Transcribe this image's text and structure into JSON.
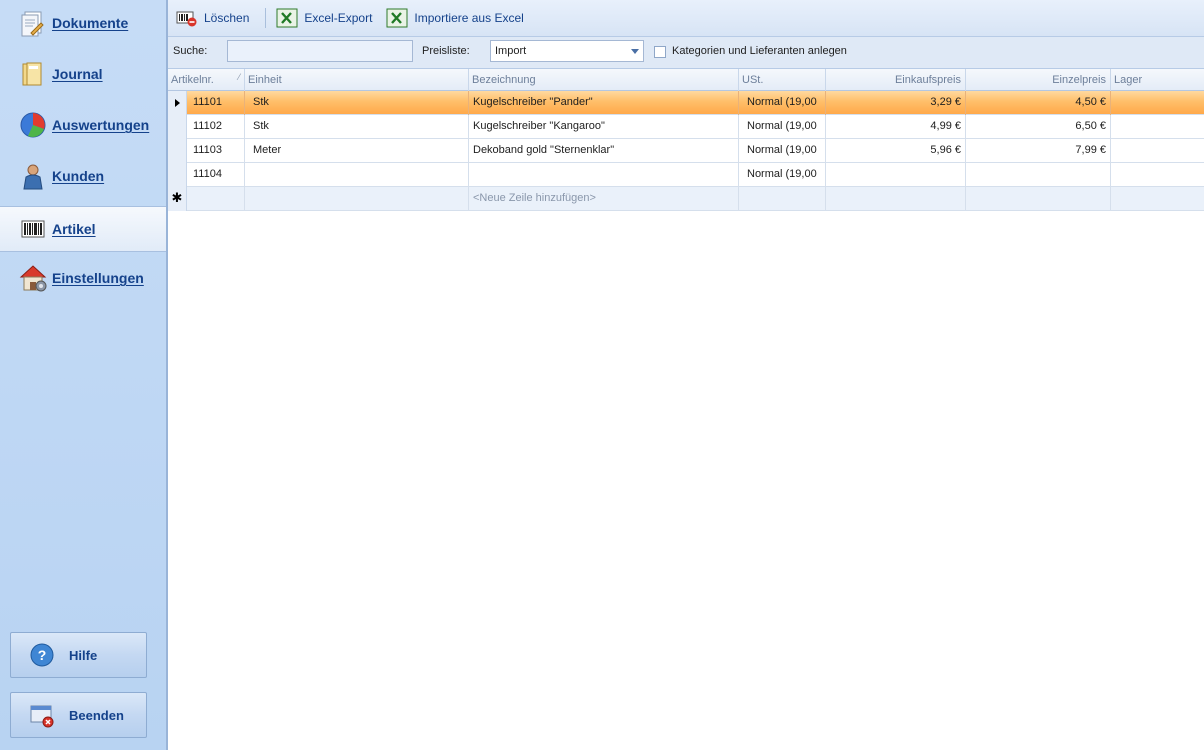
{
  "sidebar": {
    "items": [
      {
        "label": "Dokumente",
        "icon": "documents-icon"
      },
      {
        "label": "Journal",
        "icon": "journal-folder-icon"
      },
      {
        "label": "Auswertungen",
        "icon": "pie-chart-icon"
      },
      {
        "label": "Kunden",
        "icon": "customer-person-icon"
      },
      {
        "label": "Artikel",
        "icon": "barcode-icon",
        "active": true
      },
      {
        "label": "Einstellungen",
        "icon": "house-settings-icon"
      }
    ],
    "help_label": "Hilfe",
    "exit_label": "Beenden"
  },
  "toolbar": {
    "delete_label": "Löschen",
    "excel_export_label": "Excel-Export",
    "excel_import_label": "Importiere aus Excel"
  },
  "filter": {
    "search_label": "Suche:",
    "search_value": "",
    "pricelist_label": "Preisliste:",
    "pricelist_value": "Import",
    "create_categories_label": "Kategorien und Lieferanten anlegen",
    "create_categories_checked": false
  },
  "grid": {
    "columns": [
      "Artikelnr.",
      "Einheit",
      "Bezeichnung",
      "USt.",
      "Einkaufspreis",
      "Einzelpreis",
      "Lager"
    ],
    "rows": [
      {
        "nr": "11101",
        "einheit": "Stk",
        "bezeichnung": "Kugelschreiber \"Pander\"",
        "ust": "Normal (19,00",
        "einkauf": "3,29 €",
        "einzel": "4,50 €",
        "lager": ""
      },
      {
        "nr": "11102",
        "einheit": "Stk",
        "bezeichnung": "Kugelschreiber \"Kangaroo\"",
        "ust": "Normal (19,00",
        "einkauf": "4,99 €",
        "einzel": "6,50 €",
        "lager": ""
      },
      {
        "nr": "11103",
        "einheit": "Meter",
        "bezeichnung": "Dekoband gold \"Sternenklar\"",
        "ust": "Normal (19,00",
        "einkauf": "5,96 €",
        "einzel": "7,99 €",
        "lager": ""
      },
      {
        "nr": "11104",
        "einheit": "",
        "bezeichnung": "",
        "ust": "Normal (19,00",
        "einkauf": "",
        "einzel": "",
        "lager": ""
      }
    ],
    "new_row_label": "<Neue Zeile hinzufügen>"
  },
  "colors": {
    "accent": "#15428b",
    "selected_row": "#ffbf6a",
    "sidebar_bg": "#c6dcf6"
  }
}
